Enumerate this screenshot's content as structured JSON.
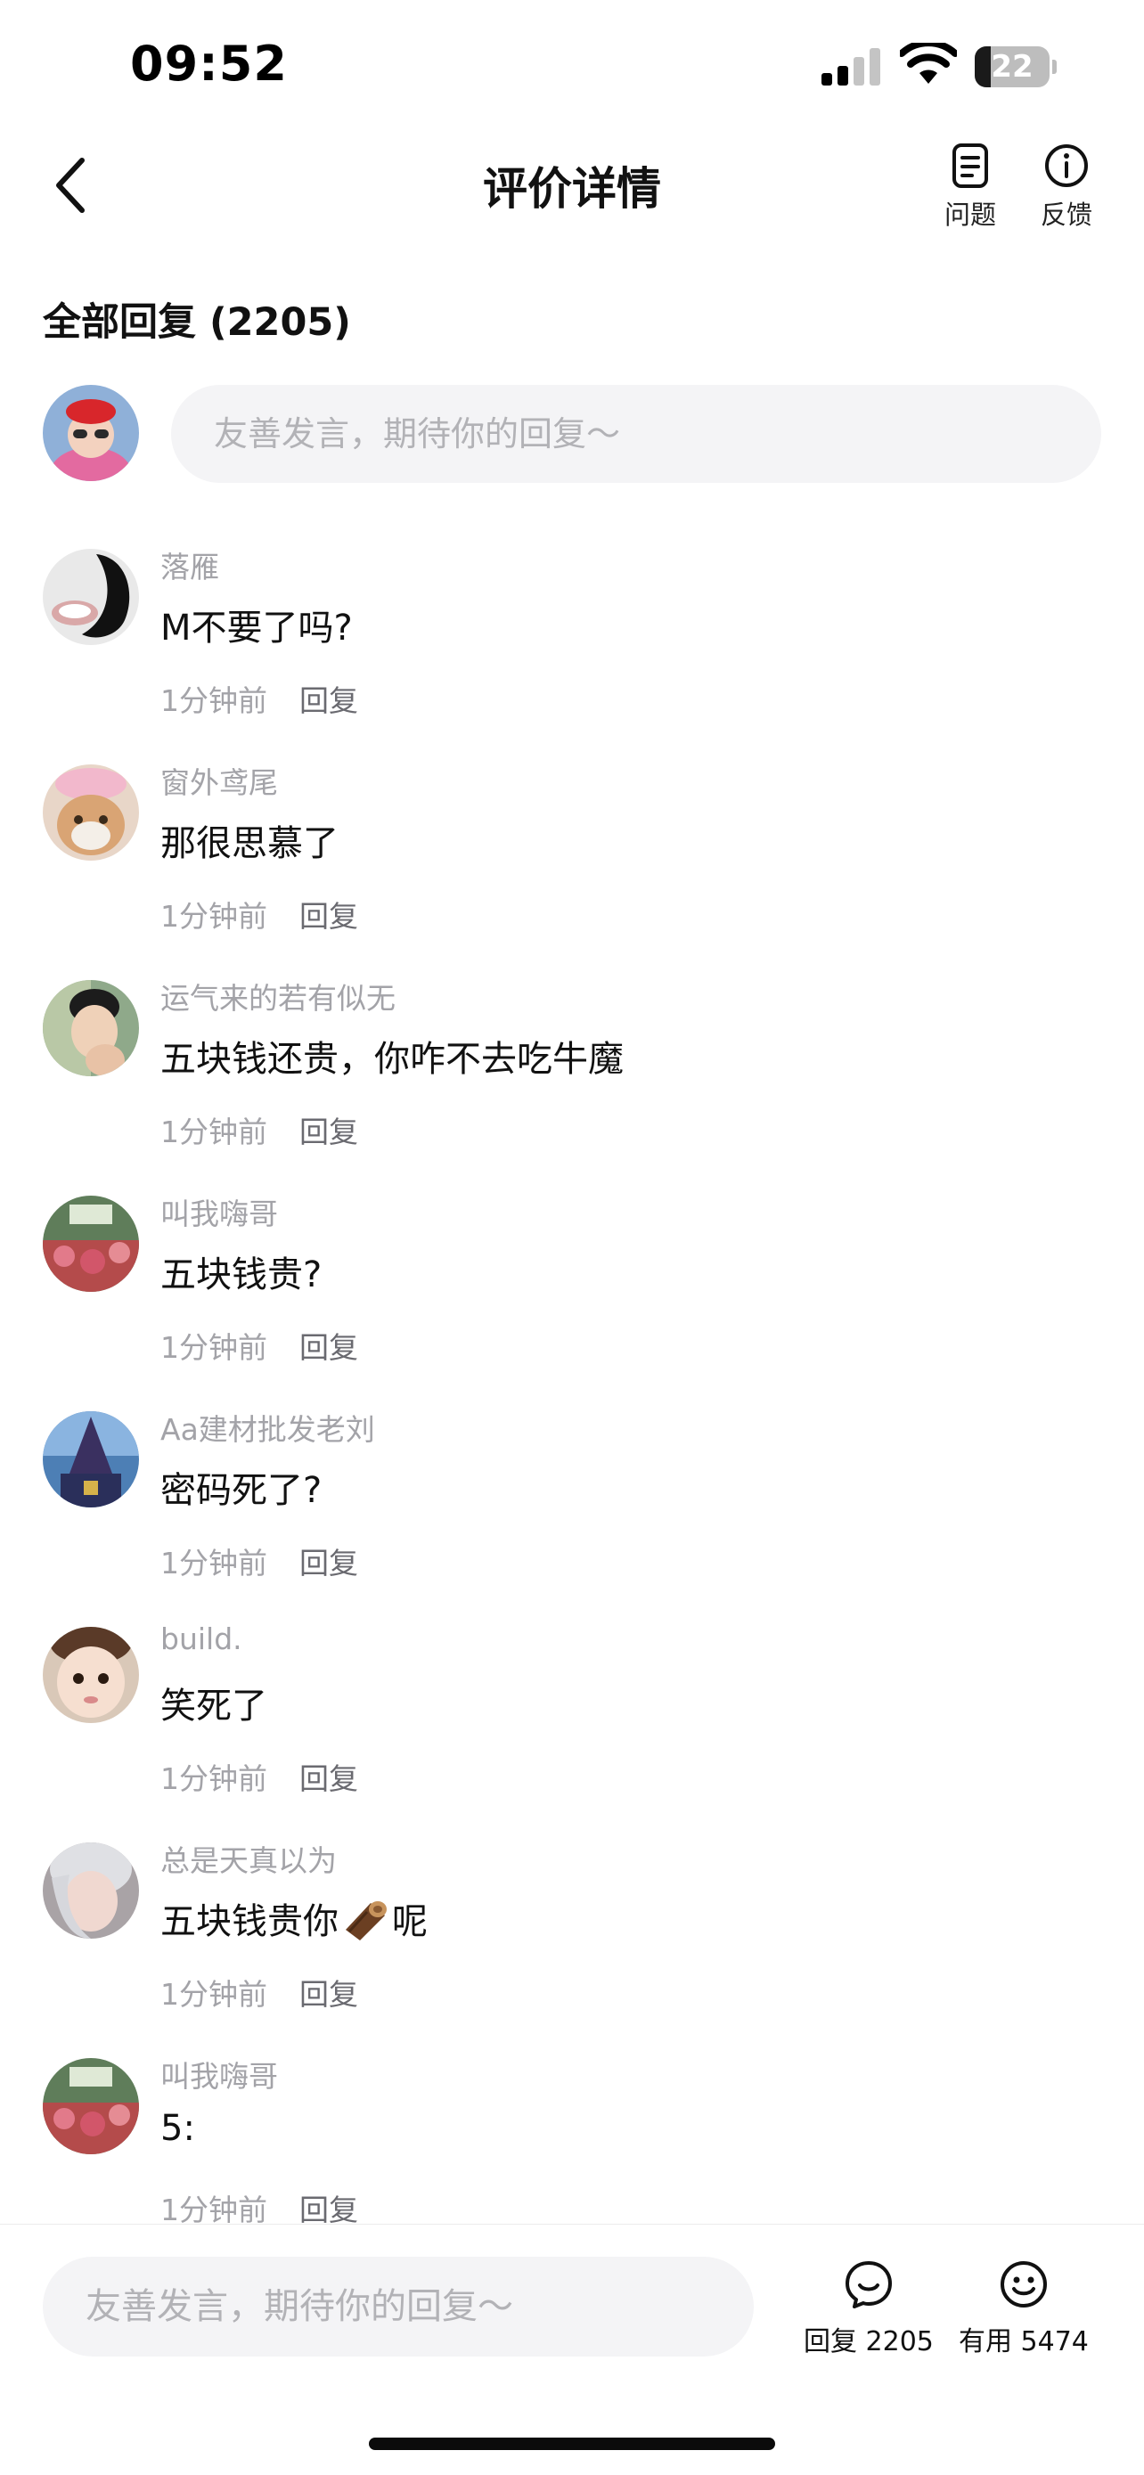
{
  "status_bar": {
    "time": "09:52",
    "battery": "22",
    "battery_level": 0.22
  },
  "nav": {
    "title": "评价详情",
    "issue_label": "问题",
    "feedback_label": "反馈"
  },
  "section": {
    "title": "全部回复 (2205)"
  },
  "composer": {
    "placeholder": "友善发言，期待你的回复～"
  },
  "comments": [
    {
      "user": "落雁",
      "text": "M不要了吗?",
      "time": "1分钟前",
      "reply": "回复"
    },
    {
      "user": "窗外鸢尾",
      "text": "那很思慕了",
      "time": "1分钟前",
      "reply": "回复"
    },
    {
      "user": "运气来的若有似无",
      "text": "五块钱还贵，你咋不去吃牛魔",
      "time": "1分钟前",
      "reply": "回复"
    },
    {
      "user": "叫我嗨哥",
      "text": "五块钱贵?",
      "time": "1分钟前",
      "reply": "回复"
    },
    {
      "user": "Aa建材批发老刘",
      "text": "密码死了?",
      "time": "1分钟前",
      "reply": "回复"
    },
    {
      "user": "build.",
      "text": "笑死了",
      "time": "1分钟前",
      "reply": "回复"
    },
    {
      "user": "总是天真以为",
      "text": "五块钱贵你",
      "text_suffix": "呢",
      "emoji": "wood-log-emoji",
      "time": "1分钟前",
      "reply": "回复"
    },
    {
      "user": "叫我嗨哥",
      "text": "5:",
      "time": "1分钟前",
      "reply": "回复"
    }
  ],
  "bottom_bar": {
    "placeholder": "友善发言，期待你的回复～",
    "reply_label": "回复 2205",
    "useful_label": "有用 5474"
  },
  "icons": {
    "back": "chevron-left-icon",
    "issue": "document-icon",
    "feedback": "info-icon",
    "reply": "chat-bubble-icon",
    "useful": "smiley-icon"
  }
}
